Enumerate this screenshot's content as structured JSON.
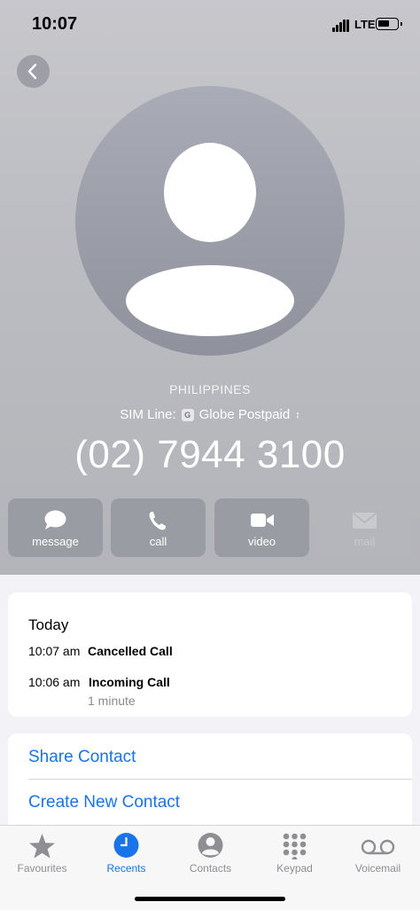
{
  "status_bar": {
    "time": "10:07",
    "network": "LTE"
  },
  "contact": {
    "country": "PHILIPPINES",
    "sim_line_label": "SIM Line:",
    "sim_badge": "G",
    "sim_carrier": "Globe Postpaid",
    "phone_number": "(02) 7944 3100"
  },
  "actions": [
    {
      "label": "message",
      "icon": "message-icon",
      "enabled": true
    },
    {
      "label": "call",
      "icon": "phone-icon",
      "enabled": true
    },
    {
      "label": "video",
      "icon": "video-icon",
      "enabled": true
    },
    {
      "label": "mail",
      "icon": "mail-icon",
      "enabled": false
    }
  ],
  "recents": {
    "heading": "Today",
    "entries": [
      {
        "time": "10:07 am",
        "type": "Cancelled Call"
      },
      {
        "time": "10:06 am",
        "type": "Incoming Call",
        "duration": "1 minute"
      }
    ]
  },
  "options": {
    "share_contact": "Share Contact",
    "create_new_contact": "Create New Contact"
  },
  "tabbar": {
    "tabs": [
      {
        "label": "Favourites",
        "icon": "star-icon"
      },
      {
        "label": "Recents",
        "icon": "clock-icon",
        "active": true
      },
      {
        "label": "Contacts",
        "icon": "person-icon"
      },
      {
        "label": "Keypad",
        "icon": "keypad-icon"
      },
      {
        "label": "Voicemail",
        "icon": "voicemail-icon"
      }
    ]
  },
  "colors": {
    "accent": "#1a73e8",
    "header_bg": "#bcbdc2",
    "action_bg": "#9a9ca4"
  }
}
